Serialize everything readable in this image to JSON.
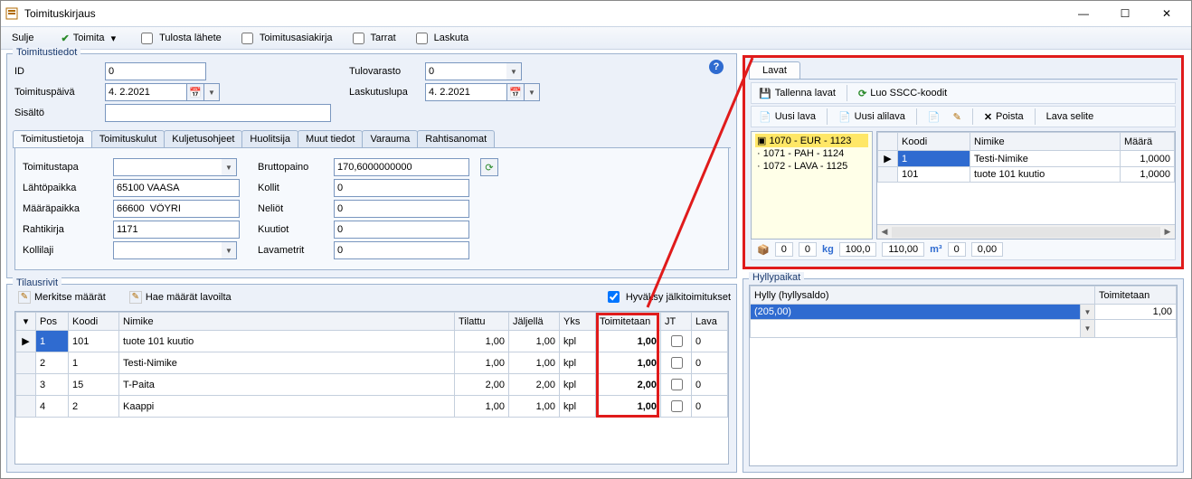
{
  "window": {
    "title": "Toimituskirjaus"
  },
  "toolbar": {
    "close": "Sulje",
    "deliver": "Toimita",
    "print_note": "Tulosta lähete",
    "delivery_doc": "Toimitusasiakirja",
    "labels": "Tarrat",
    "invoice": "Laskuta"
  },
  "details": {
    "legend": "Toimitustiedot",
    "id_label": "ID",
    "id_value": "0",
    "to_storage_label": "Tulovarasto",
    "to_storage_value": "0",
    "delivery_date_label": "Toimituspäivä",
    "delivery_date_value": "4. 2.2021",
    "invoice_perm_label": "Laskutuslupa",
    "invoice_perm_value": "4. 2.2021",
    "content_label": "Sisältö",
    "content_value": ""
  },
  "subtabs": [
    "Toimitustietoja",
    "Toimituskulut",
    "Kuljetusohjeet",
    "Huolitsija",
    "Muut tiedot",
    "Varauma",
    "Rahtisanomat"
  ],
  "delivery_info": {
    "method_label": "Toimitustapa",
    "method_value": "",
    "gross_label": "Bruttopaino",
    "gross_value": "170,6000000000",
    "from_label": "Lähtöpaikka",
    "from_value": "65100 VAASA",
    "kollit_label": "Kollit",
    "kollit_value": "0",
    "to_label": "Määräpaikka",
    "to_value": "66600  VÖYRI",
    "neliot_label": "Neliöt",
    "neliot_value": "0",
    "waybill_label": "Rahtikirja",
    "waybill_value": "1171",
    "kuutiot_label": "Kuutiot",
    "kuutiot_value": "0",
    "kollilaji_label": "Kollilaji",
    "kollilaji_value": "",
    "lavametrit_label": "Lavametrit",
    "lavametrit_value": "0"
  },
  "orderlines": {
    "legend": "Tilausrivit",
    "mark_qty": "Merkitse määrät",
    "fetch_qty": "Hae määrät lavoilta",
    "accept_backorders": "Hyväksy jälkitoimitukset",
    "cols": {
      "pos": "Pos",
      "koodi": "Koodi",
      "nimike": "Nimike",
      "tilattu": "Tilattu",
      "jaljella": "Jäljellä",
      "yks": "Yks",
      "toimitetaan": "Toimitetaan",
      "jt": "JT",
      "lava": "Lava"
    },
    "rows": [
      {
        "pos": "1",
        "koodi": "101",
        "nimike": "tuote 101 kuutio",
        "tilattu": "1,00",
        "jaljella": "1,00",
        "yks": "kpl",
        "toimitetaan": "1,00",
        "jt": false,
        "lava": "0",
        "selected": true
      },
      {
        "pos": "2",
        "koodi": "1",
        "nimike": "Testi-Nimike",
        "tilattu": "1,00",
        "jaljella": "1,00",
        "yks": "kpl",
        "toimitetaan": "1,00",
        "jt": false,
        "lava": "0"
      },
      {
        "pos": "3",
        "koodi": "15",
        "nimike": "T-Paita",
        "tilattu": "2,00",
        "jaljella": "2,00",
        "yks": "kpl",
        "toimitetaan": "2,00",
        "jt": false,
        "lava": "0"
      },
      {
        "pos": "4",
        "koodi": "2",
        "nimike": "Kaappi",
        "tilattu": "1,00",
        "jaljella": "1,00",
        "yks": "kpl",
        "toimitetaan": "1,00",
        "jt": false,
        "lava": "0"
      }
    ]
  },
  "lavat": {
    "tab": "Lavat",
    "save": "Tallenna lavat",
    "create_sscc": "Luo SSCC-koodit",
    "new": "Uusi lava",
    "new_sub": "Uusi alilava",
    "delete": "Poista",
    "desc": "Lava selite",
    "tree": [
      "1070 - EUR - 1123",
      "1071 - PAH - 1124",
      "1072 - LAVA - 1125"
    ],
    "grid_cols": {
      "koodi": "Koodi",
      "nimike": "Nimike",
      "maara": "Määrä"
    },
    "grid_rows": [
      {
        "koodi": "1",
        "nimike": "Testi-Nimike",
        "maara": "1,0000",
        "selected": true
      },
      {
        "koodi": "101",
        "nimike": "tuote 101 kuutio",
        "maara": "1,0000"
      }
    ],
    "status": {
      "box1": "0",
      "box2": "0",
      "kg": "100,0",
      "w": "110,00",
      "m3": "0",
      "last": "0,00"
    }
  },
  "hylly": {
    "legend": "Hyllypaikat",
    "col1": "Hylly (hyllysaldo)",
    "col2": "Toimitetaan",
    "row1_label": "(205,00)",
    "row1_value": "1,00"
  }
}
